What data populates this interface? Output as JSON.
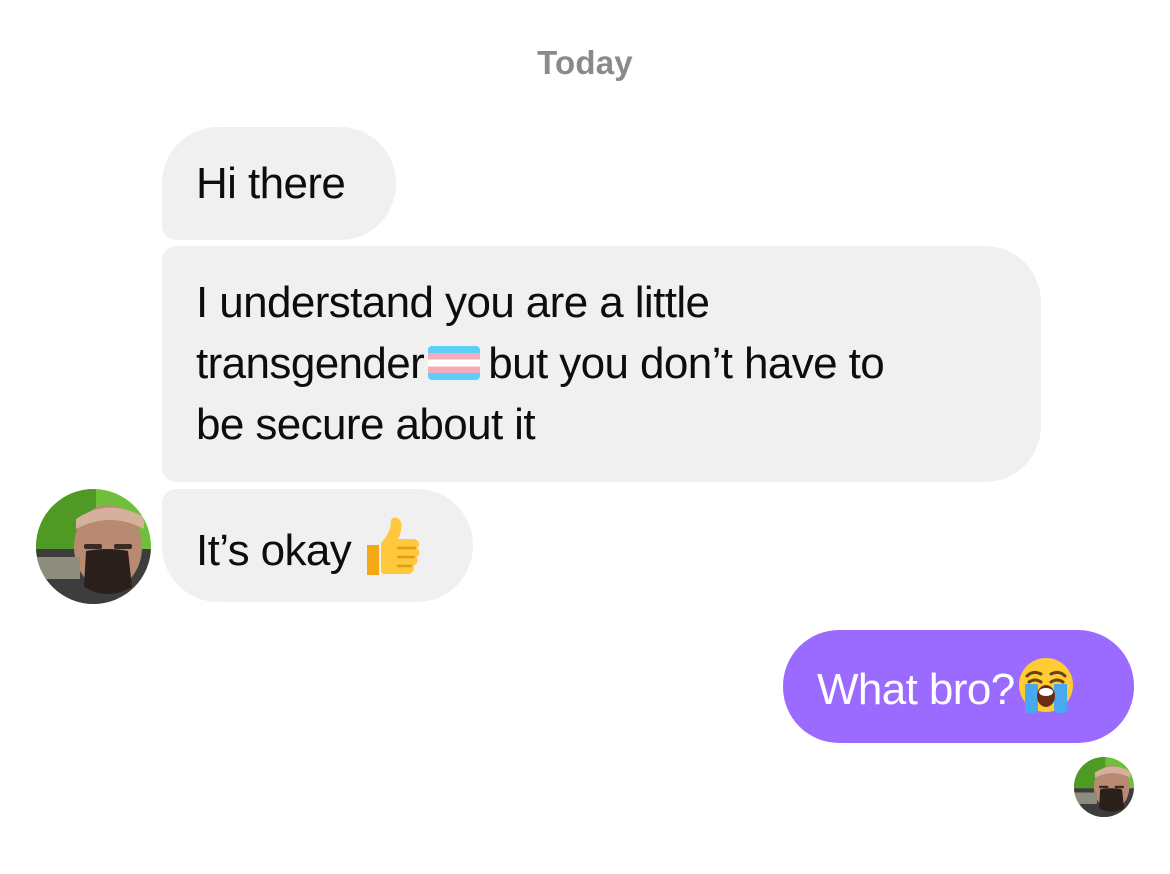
{
  "conversation": {
    "date_label": "Today",
    "incoming": {
      "message_1": "Hi there",
      "message_2": {
        "line_1": "I understand you are a little",
        "line_2_before": "transgender",
        "line_2_emoji": "transgender-flag-emoji",
        "line_2_after": "but you don’t have to",
        "line_3": "be secure about it"
      },
      "message_3": {
        "text": "It’s okay",
        "emoji": "thumbs-up-emoji"
      }
    },
    "outgoing": {
      "message_1": {
        "text": "What bro?",
        "emoji": "loudly-crying-face-emoji"
      }
    }
  },
  "colors": {
    "incoming_bubble": "#f0f0f0",
    "outgoing_bubble": "#9b6bff",
    "date_label": "#8a8a8a",
    "avatar_background": "#6fbf3a"
  }
}
